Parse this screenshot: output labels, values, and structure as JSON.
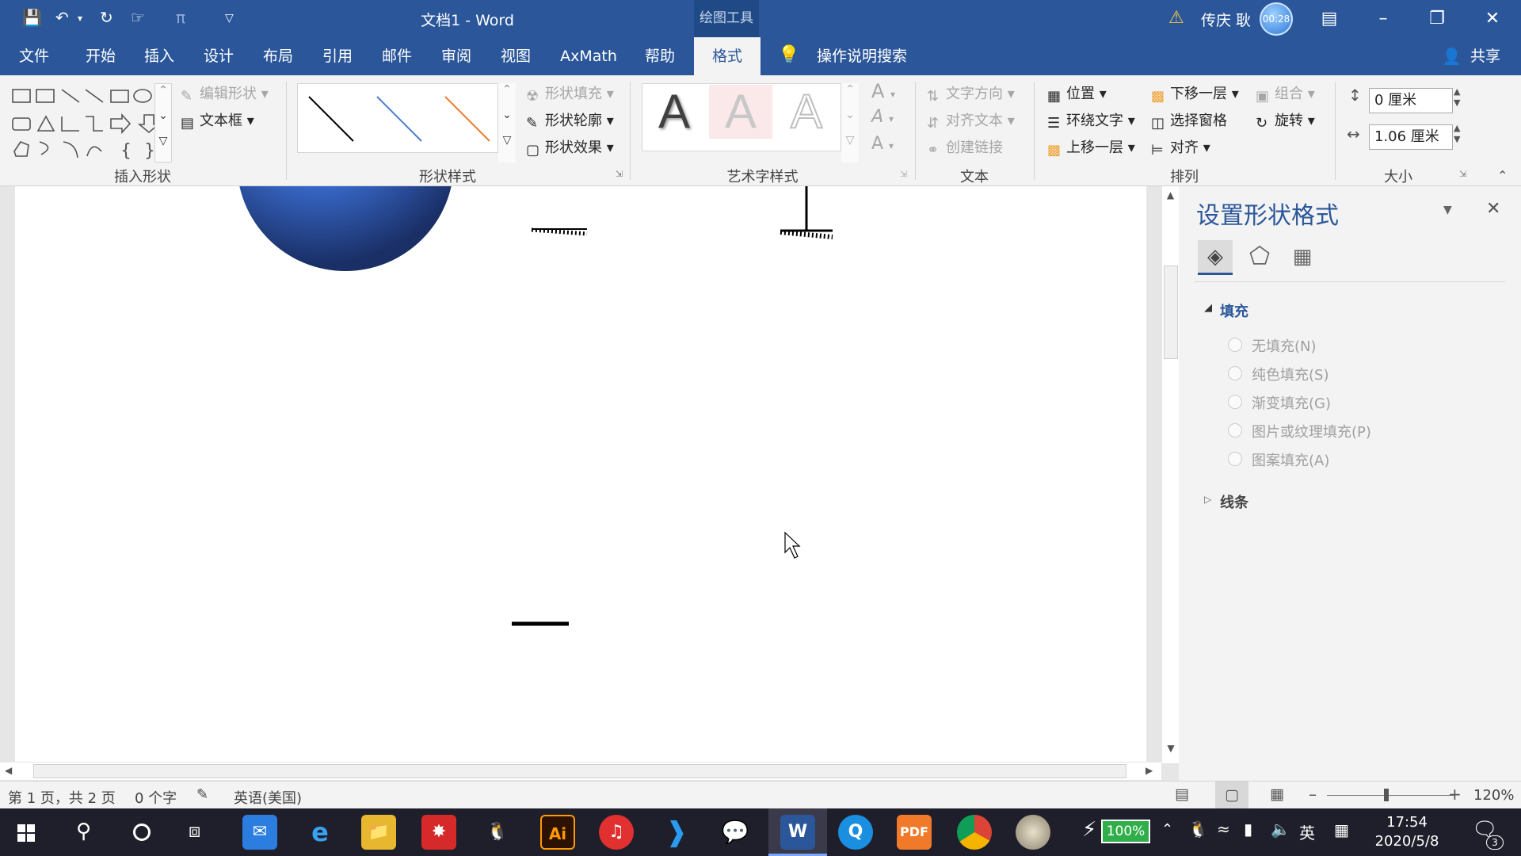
{
  "window": {
    "title": "文档1  -  Word",
    "context_tab": "绘图工具",
    "user": "传庆 耿",
    "timer": "00:28",
    "share": "共享",
    "search_hint": "操作说明搜索"
  },
  "menu": [
    "文件",
    "开始",
    "插入",
    "设计",
    "布局",
    "引用",
    "邮件",
    "审阅",
    "视图",
    "AxMath",
    "帮助",
    "格式"
  ],
  "ribbon": {
    "insert_shapes": {
      "label": "插入形状",
      "edit_shape": "编辑形状",
      "text_box": "文本框"
    },
    "shape_styles": {
      "label": "形状样式",
      "fill": "形状填充",
      "outline": "形状轮廓",
      "effects": "形状效果"
    },
    "wordart": {
      "label": "艺术字样式",
      "letter": "A"
    },
    "text": {
      "label": "文本",
      "direction": "文字方向",
      "align": "对齐文本",
      "link": "创建链接"
    },
    "arrange": {
      "label": "排列",
      "position": "位置",
      "wrap": "环绕文字",
      "forward": "上移一层",
      "backward": "下移一层",
      "selection_pane": "选择窗格",
      "align": "对齐",
      "group": "组合",
      "rotate": "旋转"
    },
    "size": {
      "label": "大小",
      "height": "0 厘米",
      "width": "1.06 厘米"
    }
  },
  "pane": {
    "title": "设置形状格式",
    "fill_section": "填充",
    "options": [
      "无填充(N)",
      "纯色填充(S)",
      "渐变填充(G)",
      "图片或纹理填充(P)",
      "图案填充(A)"
    ],
    "line_section": "线条"
  },
  "status": {
    "page": "第 1 页，共 2 页",
    "words": "0 个字",
    "language": "英语(美国)",
    "zoom": "120%"
  },
  "tray": {
    "battery": "100%",
    "ime": "英",
    "time": "17:54",
    "date": "2020/5/8",
    "notifications": "3"
  },
  "colors": {
    "accent": "#2b579a",
    "sphere": "#3b6fd4"
  }
}
